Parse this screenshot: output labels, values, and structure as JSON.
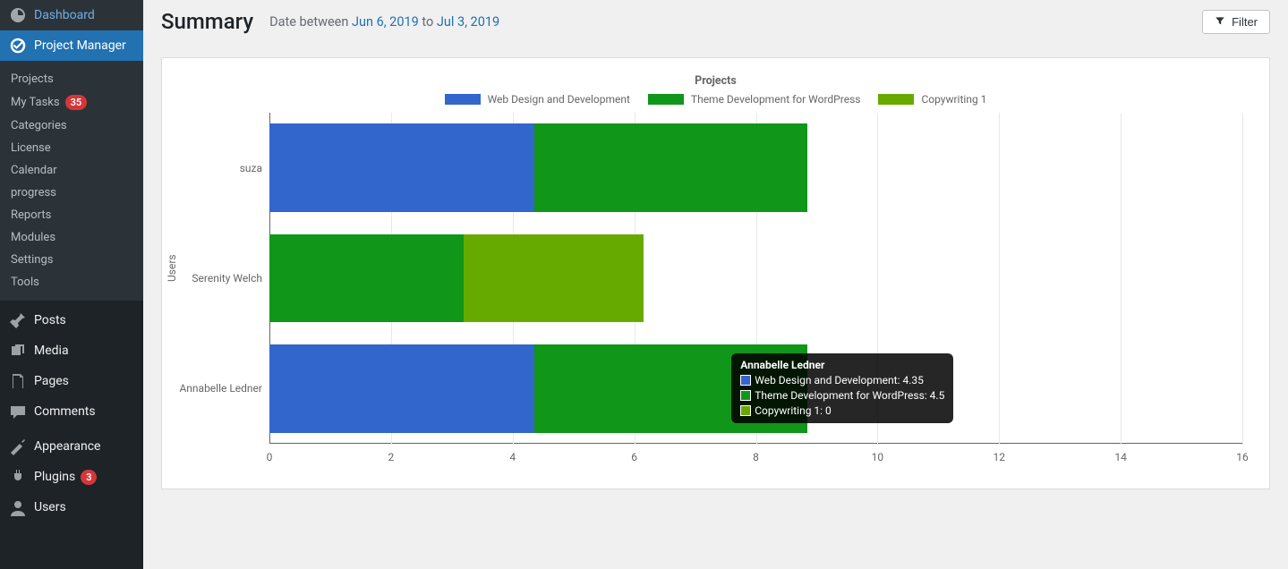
{
  "sidebar": {
    "dashboard": "Dashboard",
    "project_manager": "Project Manager",
    "submenu": [
      {
        "label": "Projects"
      },
      {
        "label": "My Tasks",
        "badge": "35"
      },
      {
        "label": "Categories"
      },
      {
        "label": "License"
      },
      {
        "label": "Calendar"
      },
      {
        "label": "progress"
      },
      {
        "label": "Reports"
      },
      {
        "label": "Modules"
      },
      {
        "label": "Settings"
      },
      {
        "label": "Tools"
      }
    ],
    "posts": "Posts",
    "media": "Media",
    "pages": "Pages",
    "comments": "Comments",
    "appearance": "Appearance",
    "plugins": "Plugins",
    "plugins_badge": "3",
    "users": "Users"
  },
  "header": {
    "title": "Summary",
    "date_prefix": "Date between ",
    "date_from": "Jun 6, 2019",
    "date_joiner": " to ",
    "date_to": "Jul 3, 2019",
    "filter": "Filter"
  },
  "chart_data": {
    "type": "bar",
    "orientation": "horizontal",
    "stacked": true,
    "title": "Projects",
    "xlabel": "",
    "ylabel": "Users",
    "xlim": [
      0,
      16
    ],
    "xticks": [
      0,
      2,
      4,
      6,
      8,
      10,
      12,
      14,
      16
    ],
    "categories": [
      "suza",
      "Serenity Welch",
      "Annabelle Ledner"
    ],
    "series": [
      {
        "name": "Web Design and Development",
        "color": "#3366cc",
        "values": [
          4.35,
          0,
          4.35
        ]
      },
      {
        "name": "Theme Development for WordPress",
        "color": "#109618",
        "values": [
          4.5,
          3.2,
          4.5
        ]
      },
      {
        "name": "Copywriting 1",
        "color": "#66aa00",
        "values": [
          0,
          2.95,
          0
        ]
      }
    ]
  },
  "tooltip": {
    "title": "Annabelle Ledner",
    "rows": [
      {
        "color": "#3366cc",
        "text": "Web Design and Development: 4.35"
      },
      {
        "color": "#109618",
        "text": "Theme Development for WordPress: 4.5"
      },
      {
        "color": "#66aa00",
        "text": "Copywriting 1: 0"
      }
    ]
  }
}
